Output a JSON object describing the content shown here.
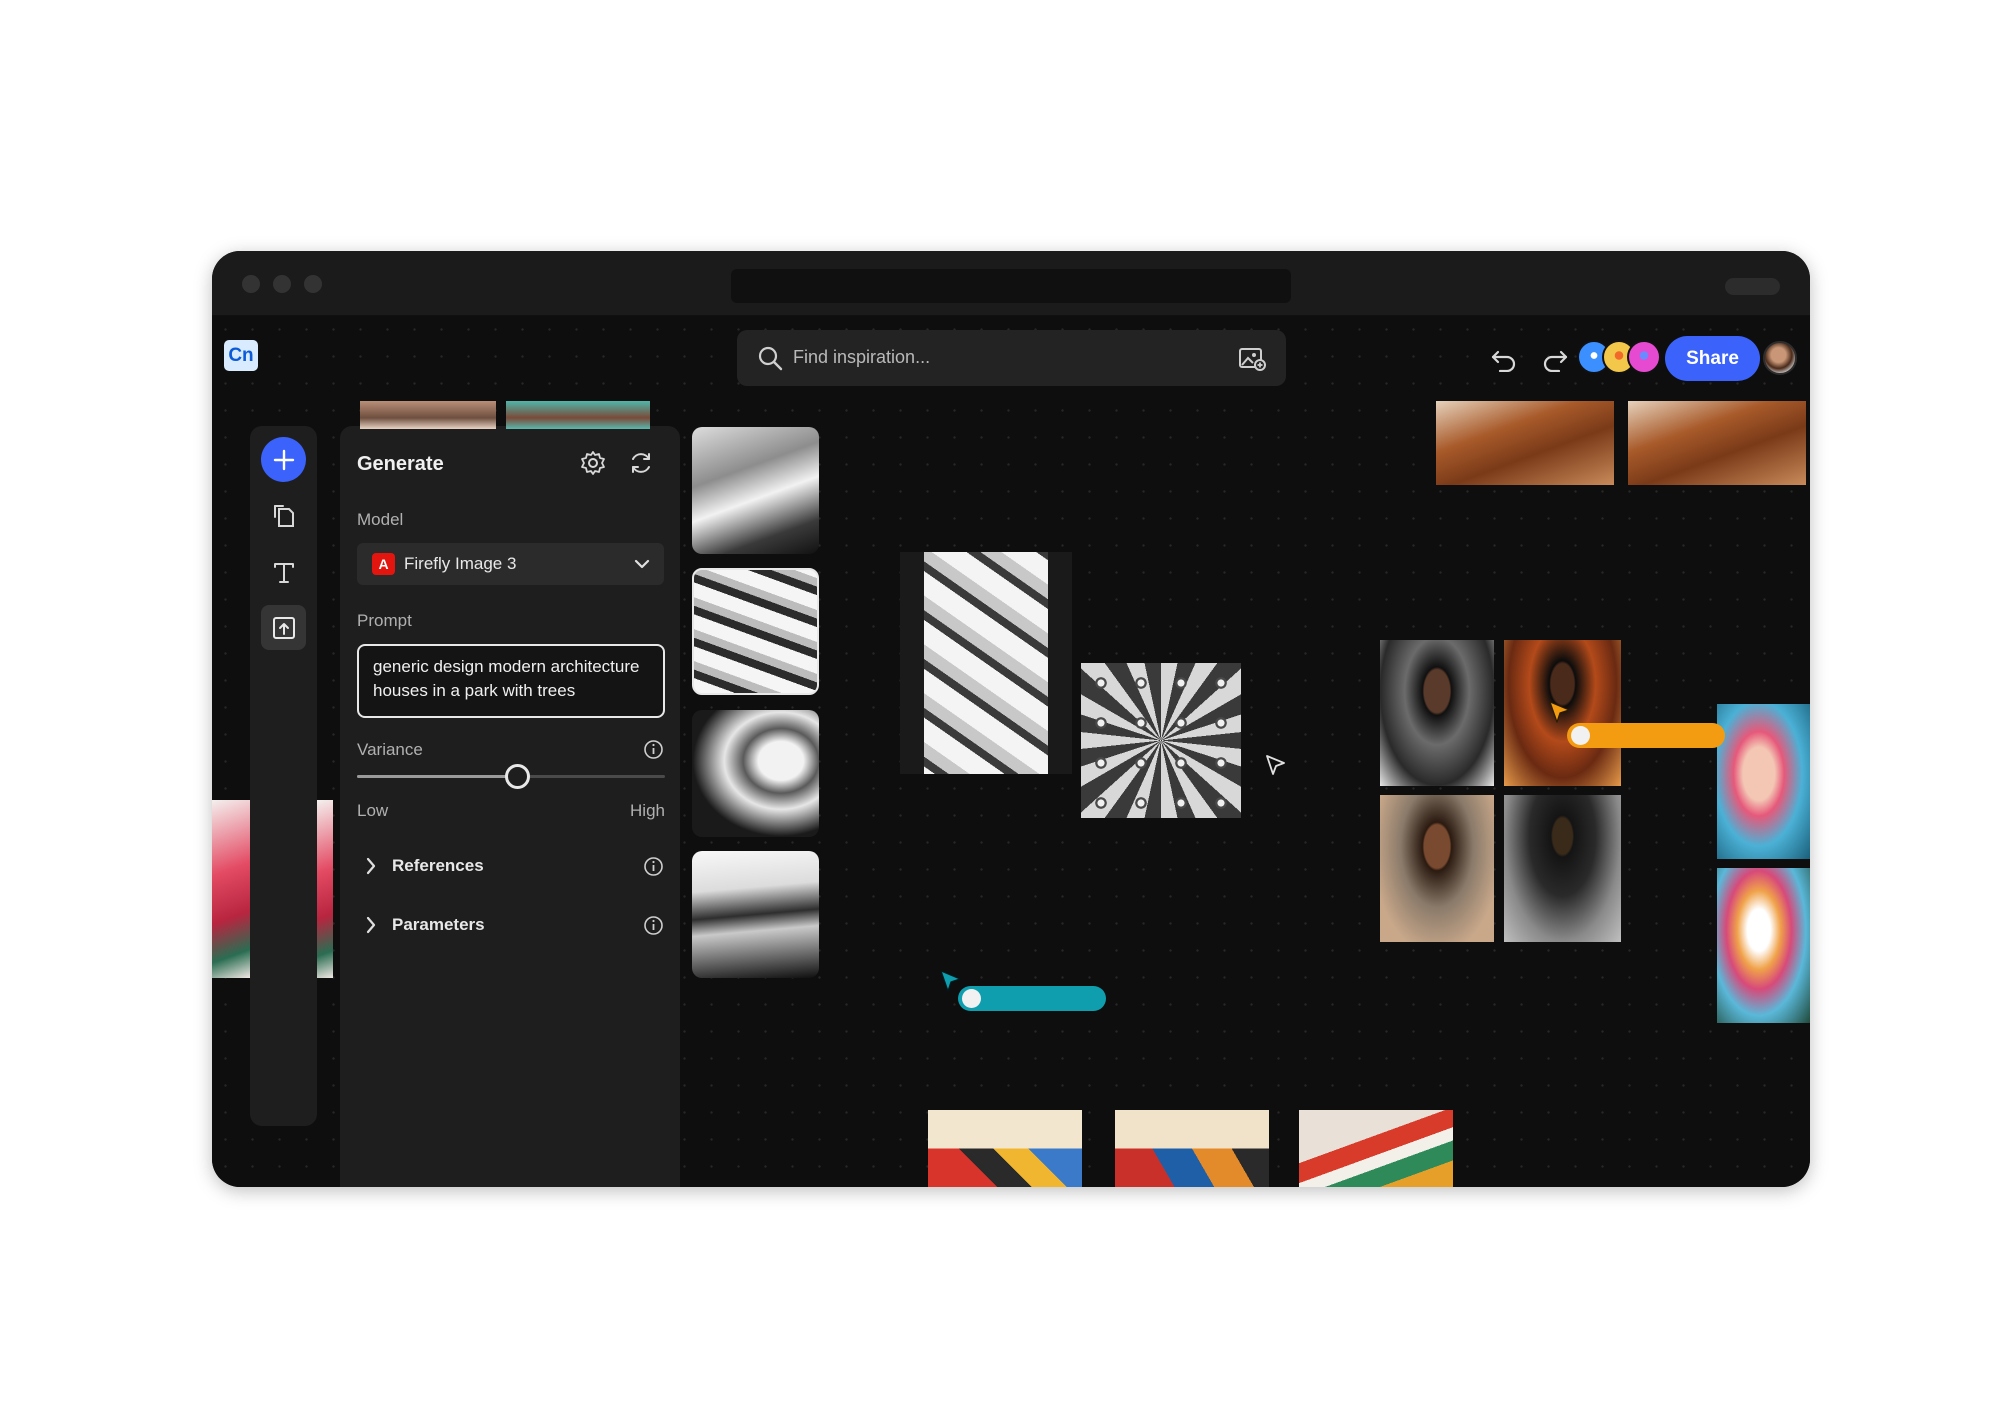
{
  "app": {
    "logo_text": "Cn",
    "search_placeholder": "Find inspiration...",
    "share_label": "Share"
  },
  "panel": {
    "title": "Generate",
    "model_label": "Model",
    "model_value": "Firefly Image 3",
    "prompt_label": "Prompt",
    "prompt_value": "generic design modern architecture houses in a park with trees",
    "variance_label": "Variance",
    "variance_value": 0.52,
    "low_label": "Low",
    "high_label": "High",
    "references_label": "References",
    "parameters_label": "Parameters"
  },
  "toolbar": {
    "icons": [
      "undo-icon",
      "redo-icon",
      "settings-icon",
      "refresh-icon",
      "search-icon",
      "image-search-icon"
    ]
  },
  "collaborators": {
    "colors": [
      "#3b8fff",
      "#f3c74a",
      "#e64ad0"
    ],
    "cursor_colors": [
      "#f39c12",
      "#0e9eae"
    ]
  },
  "colors": {
    "accent": "#3b63fb",
    "adobe_red": "#e3160f",
    "background": "#0e0e0e"
  }
}
